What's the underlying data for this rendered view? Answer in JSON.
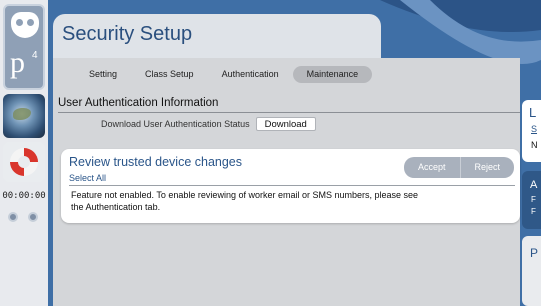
{
  "header": {
    "title": "Security Setup"
  },
  "tabs": [
    {
      "label": "Setting",
      "active": false
    },
    {
      "label": "Class Setup",
      "active": false
    },
    {
      "label": "Authentication",
      "active": false
    },
    {
      "label": "Maintenance",
      "active": true
    }
  ],
  "rail": {
    "logo_text": "p",
    "logo_superscript": "4",
    "timer": "00:00:00"
  },
  "section": {
    "title": "User Authentication Information",
    "download_label": "Download User Authentication Status",
    "download_button": "Download"
  },
  "review": {
    "title": "Review trusted device changes",
    "select_all": "Select All",
    "accept_button": "Accept",
    "reject_button": "Reject",
    "message": "Feature not enabled. To enable reviewing of worker email or SMS numbers, please see the Authentication tab."
  },
  "right_panels": {
    "panel1_letter": "L",
    "panel1_link": "S",
    "panel1_text": "N",
    "panel2_letter": "A",
    "panel2_line1": "F",
    "panel2_line2": "F",
    "panel3_letter": "P"
  },
  "colors": {
    "accent": "#2a5589",
    "background": "#3f6fa6",
    "panel": "#d4d6d9",
    "active_tab": "#b6b8bc",
    "buoy_red": "#d9352c"
  },
  "icons": [
    "owl-logo-icon",
    "globe-icon",
    "life-buoy-icon"
  ]
}
